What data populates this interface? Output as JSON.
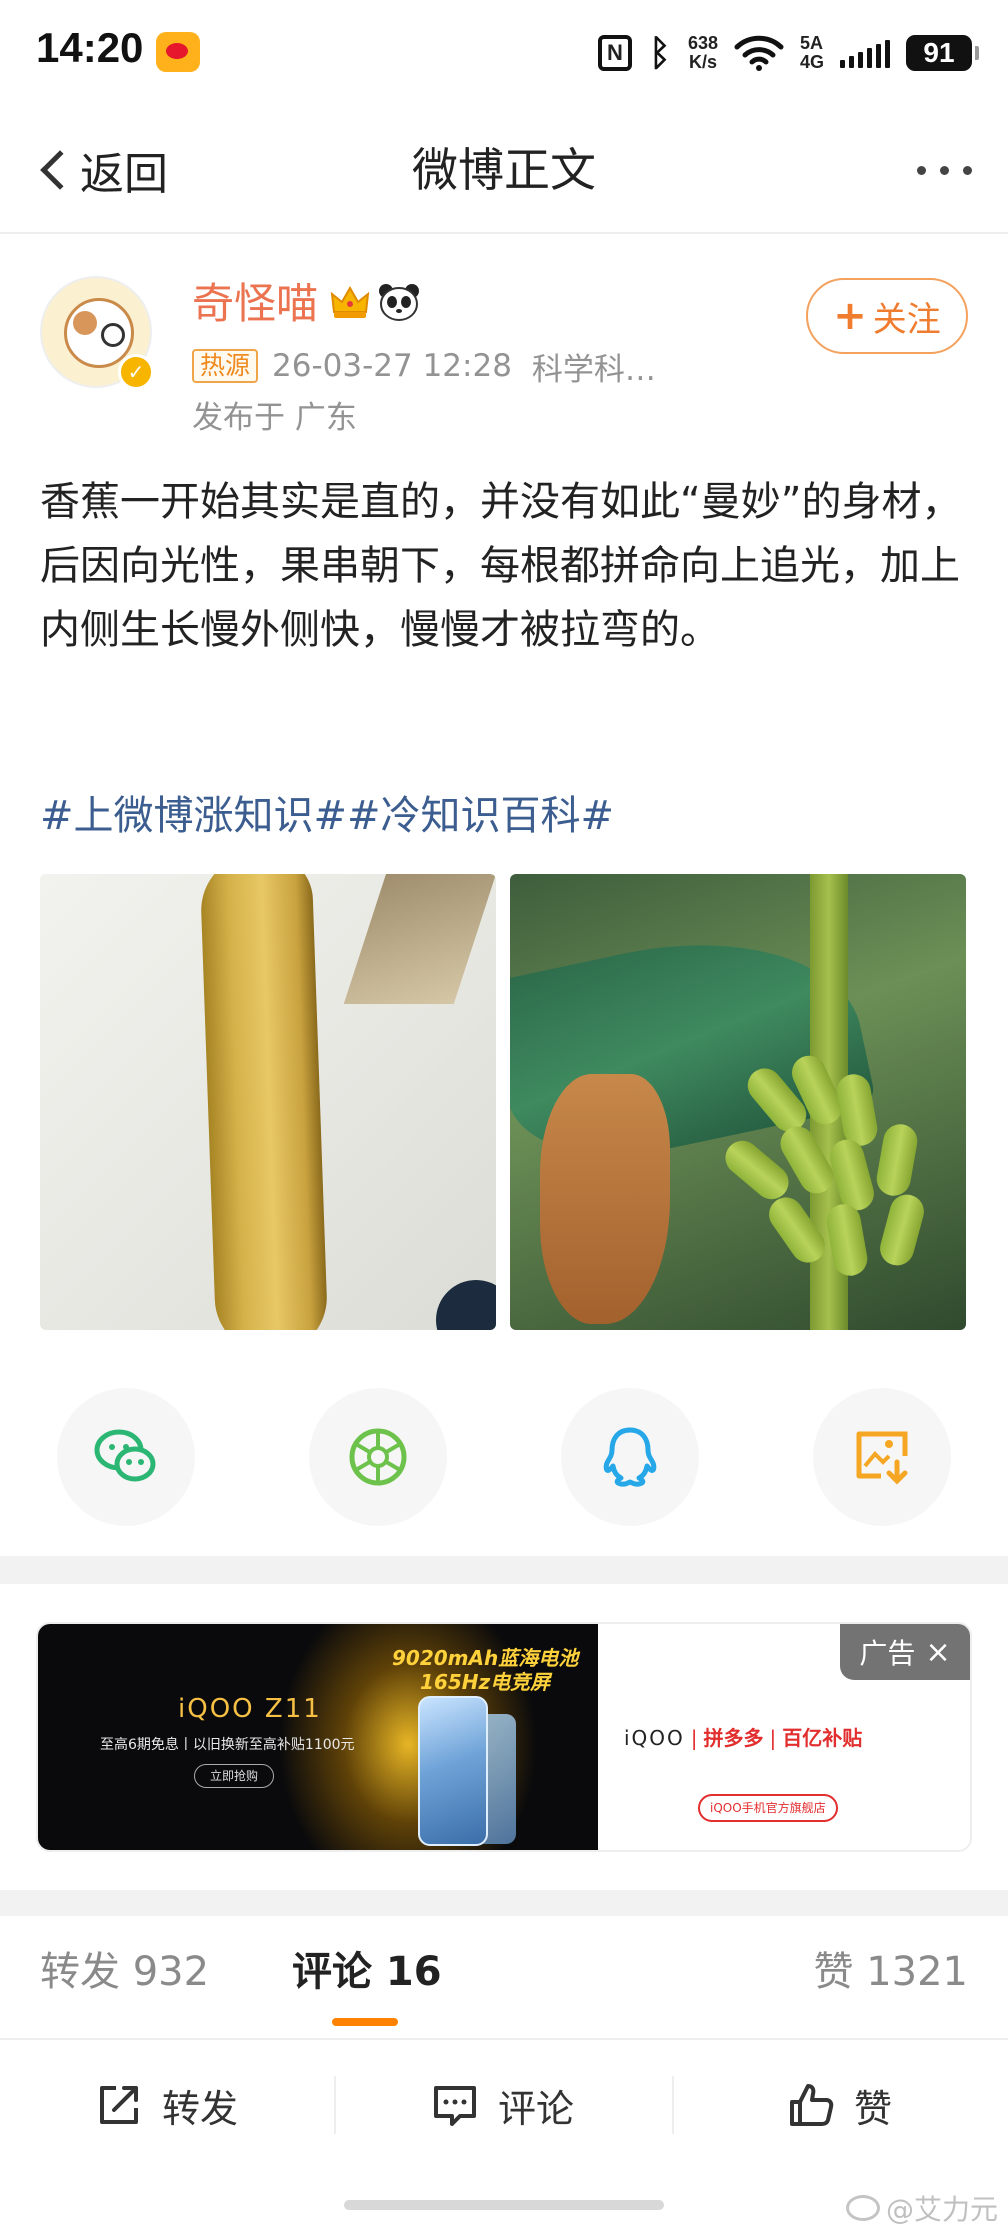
{
  "status_bar": {
    "time": "14:20",
    "net_speed_value": "638",
    "net_speed_unit": "K/s",
    "network_top": "5A",
    "network_bottom": "4G",
    "battery": "91"
  },
  "nav": {
    "back_label": "返回",
    "title": "微博正文"
  },
  "post": {
    "author": "奇怪喵",
    "follow_label": "关注",
    "hot_tag": "热源",
    "time": "26-03-27 12:28",
    "source": "科学科…",
    "location": "发布于 广东",
    "text": "香蕉一开始其实是直的，并没有如此“曼妙”的身材，后因向光性，果串朝下，每根都拼命向上追光，加上内侧生长慢外侧快，慢慢才被拉弯的。",
    "topics": [
      "#上微博涨知识#",
      "#冷知识百科#"
    ]
  },
  "share": [
    "wechat-icon",
    "moments-icon",
    "qq-icon",
    "save-image-icon"
  ],
  "ad": {
    "tag": "广告",
    "close": "×",
    "brand": "iQOO Z11",
    "sub": "至高6期免息丨以旧换新至高补贴1100元",
    "cta": "立即抢购",
    "headline_1": "9020mAh蓝海电池",
    "headline_2": "165Hz电竞屏",
    "partner_brand": "iQOO",
    "partner_1": "拼多多",
    "partner_2": "百亿补贴",
    "store": "iQOO手机官方旗舰店"
  },
  "stats": {
    "repost": "转发 932",
    "comment": "评论 16",
    "like": "赞 1321"
  },
  "bottom_bar": {
    "repost": "转发",
    "comment": "评论",
    "like": "赞"
  },
  "watermark": "@艾力元",
  "colors": {
    "accent": "#ff8200",
    "author_name": "#eb7350",
    "topic_link": "#3c5d8f",
    "follow": "#f07c2f"
  }
}
